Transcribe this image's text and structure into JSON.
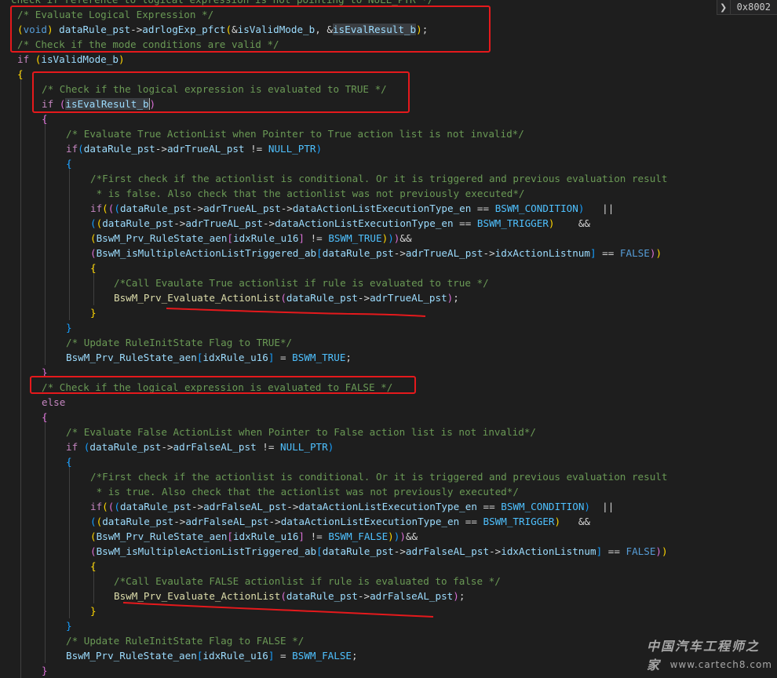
{
  "hover_badge": {
    "chevron": "chevron-right-icon",
    "value": "0x8002"
  },
  "watermark": {
    "title": "中国汽车工程师之家",
    "url": "www.cartech8.com"
  },
  "colors": {
    "annotation_red": "#e5191c",
    "background": "#1e1e1e"
  },
  "code_lines": [
    [
      {
        "t": "check if reference to logical expression is not pointing to NULL_PTR */",
        "c": "comment"
      }
    ],
    [
      {
        "t": "/* Evaluate Logical Expression */",
        "c": "comment"
      }
    ],
    [
      {
        "t": "(",
        "c": "bracket1"
      },
      {
        "t": "void",
        "c": "keyword"
      },
      {
        "t": ")",
        "c": "bracket1"
      },
      {
        "t": " ",
        "c": "punct"
      },
      {
        "t": "dataRule_pst",
        "c": "variable"
      },
      {
        "t": "->",
        "c": "punct"
      },
      {
        "t": "adrlogExp_pfct",
        "c": "variable"
      },
      {
        "t": "(",
        "c": "bracket1"
      },
      {
        "t": "&",
        "c": "punct"
      },
      {
        "t": "isValidMode_b",
        "c": "variable"
      },
      {
        "t": ", &",
        "c": "punct"
      },
      {
        "t": "isEvalResult_b",
        "c": "variable",
        "hl": true
      },
      {
        "t": ")",
        "c": "bracket1"
      },
      {
        "t": ";",
        "c": "punct"
      }
    ],
    [
      {
        "t": "/* Check if the mode conditions are valid */",
        "c": "comment"
      }
    ],
    [
      {
        "t": "if",
        "c": "control"
      },
      {
        "t": " ",
        "c": "punct"
      },
      {
        "t": "(",
        "c": "bracket1"
      },
      {
        "t": "isValidMode_b",
        "c": "variable"
      },
      {
        "t": ")",
        "c": "bracket1"
      }
    ],
    [
      {
        "t": "{",
        "c": "bracket1"
      }
    ],
    [
      {
        "t": "/* Check if the logical expression is evaluated to TRUE */",
        "c": "comment"
      }
    ],
    [
      {
        "t": "if",
        "c": "control"
      },
      {
        "t": " ",
        "c": "punct"
      },
      {
        "t": "(",
        "c": "bracket2"
      },
      {
        "t": "isEvalResult_",
        "c": "variable",
        "hl": true
      },
      {
        "t": "b",
        "c": "variable",
        "hl": true,
        "cursor": true
      },
      {
        "t": ")",
        "c": "bracket2"
      }
    ],
    [
      {
        "t": "{",
        "c": "bracket2"
      }
    ],
    [
      {
        "t": "/* Evaluate True ActionList when Pointer to True action list is not invalid*/",
        "c": "comment"
      }
    ],
    [
      {
        "t": "if",
        "c": "control"
      },
      {
        "t": "(",
        "c": "bracket3"
      },
      {
        "t": "dataRule_pst",
        "c": "variable"
      },
      {
        "t": "->",
        "c": "punct"
      },
      {
        "t": "adrTrueAL_pst",
        "c": "variable"
      },
      {
        "t": " != ",
        "c": "punct"
      },
      {
        "t": "NULL_PTR",
        "c": "macro"
      },
      {
        "t": ")",
        "c": "bracket3"
      }
    ],
    [
      {
        "t": "{",
        "c": "bracket3"
      }
    ],
    [
      {
        "t": "/*First check if the actionlist is conditional. Or it is triggered and previous evaluation result",
        "c": "comment"
      }
    ],
    [
      {
        "t": " * is false. Also check that the actionlist was not previously executed*/",
        "c": "comment"
      }
    ],
    [
      {
        "t": "if",
        "c": "control"
      },
      {
        "t": "(",
        "c": "bracket1"
      },
      {
        "t": "(",
        "c": "bracket2"
      },
      {
        "t": "(",
        "c": "bracket3"
      },
      {
        "t": "dataRule_pst",
        "c": "variable"
      },
      {
        "t": "->",
        "c": "punct"
      },
      {
        "t": "adrTrueAL_pst",
        "c": "variable"
      },
      {
        "t": "->",
        "c": "punct"
      },
      {
        "t": "dataActionListExecutionType_en",
        "c": "variable"
      },
      {
        "t": " == ",
        "c": "punct"
      },
      {
        "t": "BSWM_CONDITION",
        "c": "macro"
      },
      {
        "t": ")",
        "c": "bracket3"
      },
      {
        "t": "   ||",
        "c": "punct"
      }
    ],
    [
      {
        "t": "(",
        "c": "bracket3"
      },
      {
        "t": "(",
        "c": "bracket1"
      },
      {
        "t": "dataRule_pst",
        "c": "variable"
      },
      {
        "t": "->",
        "c": "punct"
      },
      {
        "t": "adrTrueAL_pst",
        "c": "variable"
      },
      {
        "t": "->",
        "c": "punct"
      },
      {
        "t": "dataActionListExecutionType_en",
        "c": "variable"
      },
      {
        "t": " == ",
        "c": "punct"
      },
      {
        "t": "BSWM_TRIGGER",
        "c": "macro"
      },
      {
        "t": ")",
        "c": "bracket1"
      },
      {
        "t": "    &&",
        "c": "punct"
      }
    ],
    [
      {
        "t": "(",
        "c": "bracket1"
      },
      {
        "t": "BswM_Prv_RuleState_aen",
        "c": "variable"
      },
      {
        "t": "[",
        "c": "bracket2"
      },
      {
        "t": "idxRule_u16",
        "c": "variable"
      },
      {
        "t": "]",
        "c": "bracket2"
      },
      {
        "t": " != ",
        "c": "punct"
      },
      {
        "t": "BSWM_TRUE",
        "c": "macro"
      },
      {
        "t": ")",
        "c": "bracket1"
      },
      {
        "t": ")",
        "c": "bracket3"
      },
      {
        "t": ")",
        "c": "bracket2"
      },
      {
        "t": "&&",
        "c": "punct"
      }
    ],
    [
      {
        "t": "(",
        "c": "bracket2"
      },
      {
        "t": "BswM_isMultipleActionListTriggered_ab",
        "c": "variable"
      },
      {
        "t": "[",
        "c": "bracket3"
      },
      {
        "t": "dataRule_pst",
        "c": "variable"
      },
      {
        "t": "->",
        "c": "punct"
      },
      {
        "t": "adrTrueAL_pst",
        "c": "variable"
      },
      {
        "t": "->",
        "c": "punct"
      },
      {
        "t": "idxActionListnum",
        "c": "variable"
      },
      {
        "t": "]",
        "c": "bracket3"
      },
      {
        "t": " == ",
        "c": "punct"
      },
      {
        "t": "FALSE",
        "c": "keyword"
      },
      {
        "t": ")",
        "c": "bracket2"
      },
      {
        "t": ")",
        "c": "bracket1"
      }
    ],
    [
      {
        "t": "{",
        "c": "bracket1"
      }
    ],
    [
      {
        "t": "/*Call Evaulate True actionlist if rule is evaluated to true */",
        "c": "comment"
      }
    ],
    [
      {
        "t": "BswM_Prv_Evaluate_ActionList",
        "c": "function"
      },
      {
        "t": "(",
        "c": "bracket2"
      },
      {
        "t": "dataRule_pst",
        "c": "variable"
      },
      {
        "t": "->",
        "c": "punct"
      },
      {
        "t": "adrTrueAL_pst",
        "c": "variable"
      },
      {
        "t": ")",
        "c": "bracket2"
      },
      {
        "t": ";",
        "c": "punct"
      }
    ],
    [
      {
        "t": "}",
        "c": "bracket1"
      }
    ],
    [
      {
        "t": "}",
        "c": "bracket3"
      }
    ],
    [
      {
        "t": "/* Update RuleInitState Flag to TRUE*/",
        "c": "comment"
      }
    ],
    [
      {
        "t": "BswM_Prv_RuleState_aen",
        "c": "variable"
      },
      {
        "t": "[",
        "c": "bracket3"
      },
      {
        "t": "idxRule_u16",
        "c": "variable"
      },
      {
        "t": "]",
        "c": "bracket3"
      },
      {
        "t": " = ",
        "c": "punct"
      },
      {
        "t": "BSWM_TRUE",
        "c": "macro"
      },
      {
        "t": ";",
        "c": "punct"
      }
    ],
    [
      {
        "t": "}",
        "c": "bracket2"
      }
    ],
    [
      {
        "t": "/* Check if the logical expression is evaluated to FALSE */",
        "c": "comment"
      }
    ],
    [
      {
        "t": "else",
        "c": "control"
      }
    ],
    [
      {
        "t": "{",
        "c": "bracket2"
      }
    ],
    [
      {
        "t": "/* Evaluate False ActionList when Pointer to False action list is not invalid*/",
        "c": "comment"
      }
    ],
    [
      {
        "t": "if",
        "c": "control"
      },
      {
        "t": " ",
        "c": "punct"
      },
      {
        "t": "(",
        "c": "bracket3"
      },
      {
        "t": "dataRule_pst",
        "c": "variable"
      },
      {
        "t": "->",
        "c": "punct"
      },
      {
        "t": "adrFalseAL_pst",
        "c": "variable"
      },
      {
        "t": " != ",
        "c": "punct"
      },
      {
        "t": "NULL_PTR",
        "c": "macro"
      },
      {
        "t": ")",
        "c": "bracket3"
      }
    ],
    [
      {
        "t": "{",
        "c": "bracket3"
      }
    ],
    [
      {
        "t": "/*First check if the actionlist is conditional. Or it is triggered and previous evaluation result",
        "c": "comment"
      }
    ],
    [
      {
        "t": " * is true. Also check that the actionlist was not previously executed*/",
        "c": "comment"
      }
    ],
    [
      {
        "t": "if",
        "c": "control"
      },
      {
        "t": "(",
        "c": "bracket1"
      },
      {
        "t": "(",
        "c": "bracket2"
      },
      {
        "t": "(",
        "c": "bracket3"
      },
      {
        "t": "dataRule_pst",
        "c": "variable"
      },
      {
        "t": "->",
        "c": "punct"
      },
      {
        "t": "adrFalseAL_pst",
        "c": "variable"
      },
      {
        "t": "->",
        "c": "punct"
      },
      {
        "t": "dataActionListExecutionType_en",
        "c": "variable"
      },
      {
        "t": " == ",
        "c": "punct"
      },
      {
        "t": "BSWM_CONDITION",
        "c": "macro"
      },
      {
        "t": ")",
        "c": "bracket3"
      },
      {
        "t": "  ||",
        "c": "punct"
      }
    ],
    [
      {
        "t": "(",
        "c": "bracket3"
      },
      {
        "t": "(",
        "c": "bracket1"
      },
      {
        "t": "dataRule_pst",
        "c": "variable"
      },
      {
        "t": "->",
        "c": "punct"
      },
      {
        "t": "adrFalseAL_pst",
        "c": "variable"
      },
      {
        "t": "->",
        "c": "punct"
      },
      {
        "t": "dataActionListExecutionType_en",
        "c": "variable"
      },
      {
        "t": " == ",
        "c": "punct"
      },
      {
        "t": "BSWM_TRIGGER",
        "c": "macro"
      },
      {
        "t": ")",
        "c": "bracket1"
      },
      {
        "t": "   &&",
        "c": "punct"
      }
    ],
    [
      {
        "t": "(",
        "c": "bracket1"
      },
      {
        "t": "BswM_Prv_RuleState_aen",
        "c": "variable"
      },
      {
        "t": "[",
        "c": "bracket2"
      },
      {
        "t": "idxRule_u16",
        "c": "variable"
      },
      {
        "t": "]",
        "c": "bracket2"
      },
      {
        "t": " != ",
        "c": "punct"
      },
      {
        "t": "BSWM_FALSE",
        "c": "macro"
      },
      {
        "t": ")",
        "c": "bracket1"
      },
      {
        "t": ")",
        "c": "bracket3"
      },
      {
        "t": ")",
        "c": "bracket2"
      },
      {
        "t": "&&",
        "c": "punct"
      }
    ],
    [
      {
        "t": "(",
        "c": "bracket2"
      },
      {
        "t": "BswM_isMultipleActionListTriggered_ab",
        "c": "variable"
      },
      {
        "t": "[",
        "c": "bracket3"
      },
      {
        "t": "dataRule_pst",
        "c": "variable"
      },
      {
        "t": "->",
        "c": "punct"
      },
      {
        "t": "adrFalseAL_pst",
        "c": "variable"
      },
      {
        "t": "->",
        "c": "punct"
      },
      {
        "t": "idxActionListnum",
        "c": "variable"
      },
      {
        "t": "]",
        "c": "bracket3"
      },
      {
        "t": " == ",
        "c": "punct"
      },
      {
        "t": "FALSE",
        "c": "keyword"
      },
      {
        "t": ")",
        "c": "bracket2"
      },
      {
        "t": ")",
        "c": "bracket1"
      }
    ],
    [
      {
        "t": "{",
        "c": "bracket1"
      }
    ],
    [
      {
        "t": "/*Call Evaulate FALSE actionlist if rule is evaluated to false */",
        "c": "comment"
      }
    ],
    [
      {
        "t": "BswM_Prv_Evaluate_ActionList",
        "c": "function"
      },
      {
        "t": "(",
        "c": "bracket2"
      },
      {
        "t": "dataRule_pst",
        "c": "variable"
      },
      {
        "t": "->",
        "c": "punct"
      },
      {
        "t": "adrFalseAL_pst",
        "c": "variable"
      },
      {
        "t": ")",
        "c": "bracket2"
      },
      {
        "t": ";",
        "c": "punct"
      }
    ],
    [
      {
        "t": "}",
        "c": "bracket1"
      }
    ],
    [
      {
        "t": "}",
        "c": "bracket3"
      }
    ],
    [
      {
        "t": "/* Update RuleInitState Flag to FALSE */",
        "c": "comment"
      }
    ],
    [
      {
        "t": "BswM_Prv_RuleState_aen",
        "c": "variable"
      },
      {
        "t": "[",
        "c": "bracket3"
      },
      {
        "t": "idxRule_u16",
        "c": "variable"
      },
      {
        "t": "]",
        "c": "bracket3"
      },
      {
        "t": " = ",
        "c": "punct"
      },
      {
        "t": "BSWM_FALSE",
        "c": "macro"
      },
      {
        "t": ";",
        "c": "punct"
      }
    ],
    [
      {
        "t": "}",
        "c": "bracket2"
      }
    ]
  ]
}
